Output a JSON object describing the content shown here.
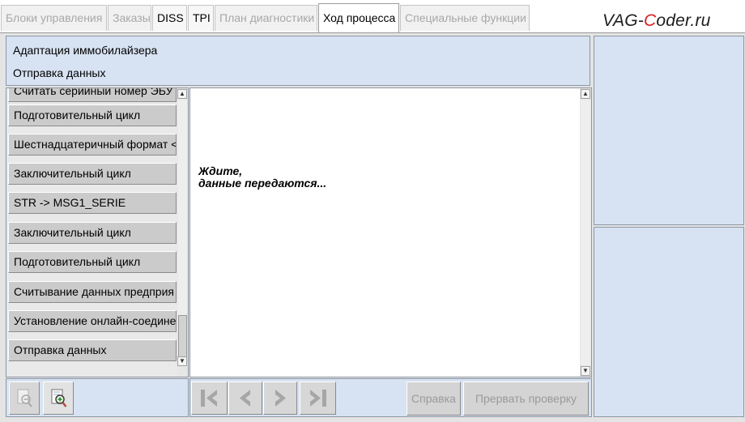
{
  "tabs": [
    {
      "label": "Блоки управления",
      "state": "disabled"
    },
    {
      "label": "Заказы",
      "state": "disabled"
    },
    {
      "label": "DISS",
      "state": "enabled"
    },
    {
      "label": "TPI",
      "state": "enabled"
    },
    {
      "label": "План диагностики",
      "state": "disabled"
    },
    {
      "label": "Ход процесса",
      "state": "selected"
    },
    {
      "label": "Специальные функции",
      "state": "disabled"
    }
  ],
  "watermark": {
    "before": "VAG-",
    "highlight": "C",
    "after": "oder.ru"
  },
  "header": {
    "line1": "Адаптация иммобилайзера",
    "line2": "Отправка данных"
  },
  "steps": [
    "Считать серийный номер ЭБУ д",
    "Подготовительный цикл",
    "Шестнадцатеричный формат <",
    "Заключительный цикл",
    "STR -> MSG1_SERIE",
    "Заключительный цикл",
    "Подготовительный цикл",
    "Считывание данных предприя",
    "Установление онлайн-соедине",
    "Отправка данных"
  ],
  "message": {
    "line1": "Ждите,",
    "line2": "данные передаются..."
  },
  "buttons": {
    "help": "Справка",
    "abort": "Прервать проверку"
  },
  "icons": {
    "zoom_out": "zoom-out-icon",
    "zoom_in": "zoom-in-icon",
    "first": "skip-first-icon",
    "prev": "prev-icon",
    "next": "next-icon",
    "last": "skip-last-icon"
  },
  "colors": {
    "panel": "#d7e2f2",
    "watermark_accent": "#d82020"
  }
}
